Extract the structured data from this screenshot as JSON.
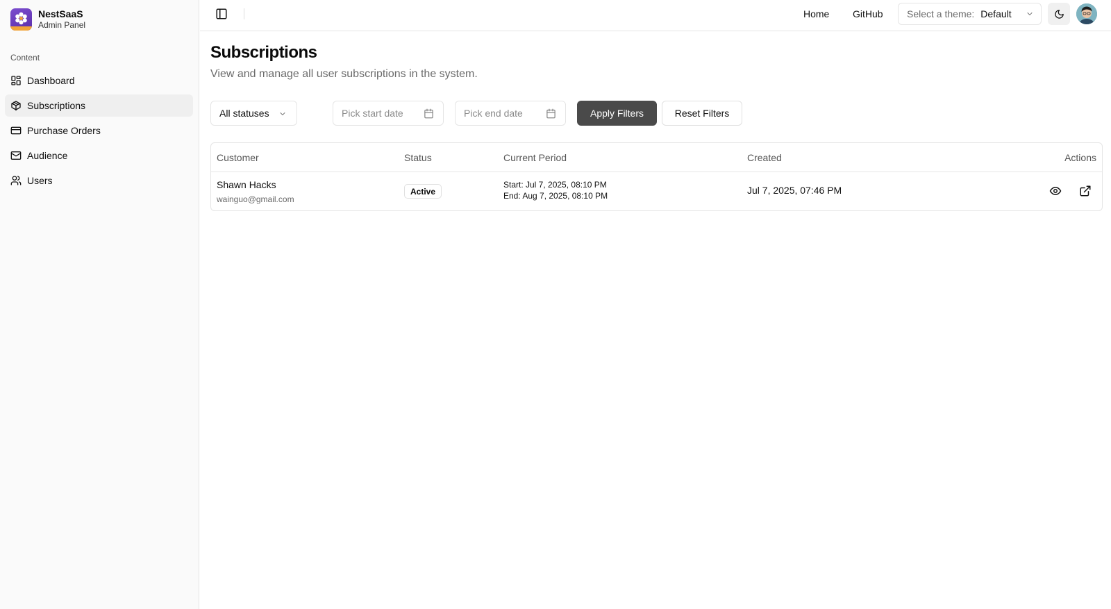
{
  "brand": {
    "name": "NestSaaS",
    "subtitle": "Admin Panel"
  },
  "sidebar": {
    "section_label": "Content",
    "items": [
      {
        "label": "Dashboard",
        "icon": "dashboard-icon",
        "active": false
      },
      {
        "label": "Subscriptions",
        "icon": "package-icon",
        "active": true
      },
      {
        "label": "Purchase Orders",
        "icon": "credit-card-icon",
        "active": false
      },
      {
        "label": "Audience",
        "icon": "mail-icon",
        "active": false
      },
      {
        "label": "Users",
        "icon": "users-icon",
        "active": false
      }
    ]
  },
  "header": {
    "links": [
      "Home",
      "GitHub"
    ],
    "theme_prefix": "Select a theme:",
    "theme_value": "Default"
  },
  "page": {
    "title": "Subscriptions",
    "description": "View and manage all user subscriptions in the system."
  },
  "filters": {
    "status": "All statuses",
    "start_date_placeholder": "Pick start date",
    "end_date_placeholder": "Pick end date",
    "apply_label": "Apply Filters",
    "reset_label": "Reset Filters"
  },
  "table": {
    "columns": [
      "Customer",
      "Status",
      "Current Period",
      "Created",
      "Actions"
    ],
    "rows": [
      {
        "customer_name": "Shawn Hacks",
        "customer_email": "wainguo@gmail.com",
        "status": "Active",
        "period_start": "Start: Jul 7, 2025, 08:10 PM",
        "period_end": "End: Aug 7, 2025, 08:10 PM",
        "created": "Jul 7, 2025, 07:46 PM"
      }
    ]
  },
  "colors": {
    "primary_button": "#4a4a4a",
    "active_nav": "#efefef",
    "logo": "#6a3cc0"
  }
}
